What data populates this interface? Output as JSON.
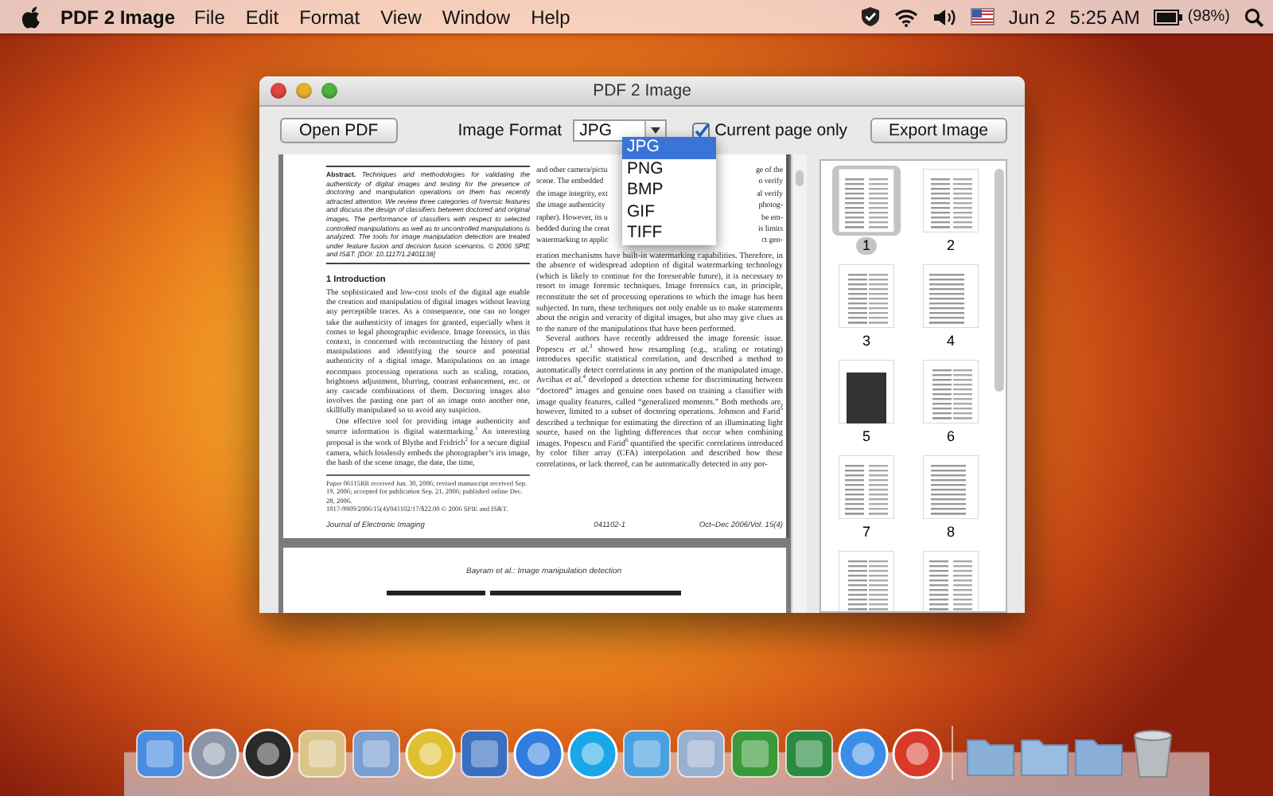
{
  "menu_bar": {
    "app_name": "PDF 2 Image",
    "menus": [
      "File",
      "Edit",
      "Format",
      "View",
      "Window",
      "Help"
    ],
    "date": "Jun 2",
    "time": "5:25 AM",
    "battery": "(98%)"
  },
  "window": {
    "title": "PDF 2 Image"
  },
  "toolbar": {
    "open_button": "Open PDF",
    "format_label": "Image Format",
    "format_value": "JPG",
    "current_page_only": {
      "label": "Current page only",
      "checked": true
    },
    "export_button": "Export Image"
  },
  "format_menu": {
    "options": [
      {
        "label": "JPG",
        "selected": true
      },
      {
        "label": "PNG",
        "selected": false
      },
      {
        "label": "BMP",
        "selected": false
      },
      {
        "label": "GIF",
        "selected": false
      },
      {
        "label": "TIFF",
        "selected": false
      }
    ]
  },
  "document": {
    "page": {
      "abstract": "**Abstract.** Techniques and methodologies for validating the authenticity of digital images and testing for the presence of doctoring and manipulation operations on them has recently attracted attention. We review three categories of forensic features and discuss the design of classifiers between doctored and original images. The performance of classifiers with respect to selected controlled manipulations as well as to uncontrolled manipulations is analyzed. The tools for image manipulation detection are treated under feature fusion and decision fusion scenarios. © 2006 SPIE and IS&T. [DOI: 10.1117/1.2401138]",
      "heading": "1 Introduction",
      "left_paragraphs": [
        "The sophisticated and low-cost tools of the digital age enable the creation and manipulation of digital images without leaving any perceptible traces. As a consequence, one can no longer take the authenticity of images for granted, especially when it comes to legal photographic evidence. Image forensics, in this context, is concerned with reconstructing the history of past manipulations and identifying the source and potential authenticity of a digital image. Manipulations on an image encompass processing operations such as scaling, rotation, brightness adjustment, blurring, contrast enhancement, etc. or any cascade combinations of them. Doctoring images also involves the pasting one part of an image onto another one, skillfully manipulated so to avoid any suspicion.",
        "One effective tool for providing image authenticity and source information is digital watermarking.$^{1}$ An interesting proposal is the work of Blythe and Fridrich$^{2}$ for a secure digital camera, which losslessly embeds the photographer’s iris image, the hash of the scene image, the date, the time,"
      ],
      "footnotes": [
        "Paper 06115RR received Jun. 30, 2006; revised manuscript received Sep. 19, 2006; accepted for publication Sep. 21, 2006; published online Dec. 28, 2006.",
        "1017-9909/2006/15(4)/041102/17/$22.00 © 2006 SPIE and IS&T."
      ],
      "covered_lines": [
        {
          "left": "and other camera/pictu",
          "right": "ge of the"
        },
        {
          "left": "scene. The embedded",
          "right": "o verify"
        },
        {
          "left": "the image integrity, ext",
          "right": "al verify"
        },
        {
          "left": "the image authenticity",
          "right": "photog-"
        },
        {
          "left": "rapher). However, its u",
          "right": "be em-"
        },
        {
          "left": "bedded during the creat",
          "right": "is limits"
        },
        {
          "left": "watermarking to applic",
          "right": "ct gen-"
        }
      ],
      "right_paragraphs": [
        "eration mechanisms have built-in watermarking capabilities. Therefore, in the absence of widespread adoption of digital watermarking technology (which is likely to continue for the foreseeable future), it is necessary to resort to image forensic techniques. Image forensics can, in principle, reconstitute the set of processing operations to which the image has been subjected. In turn, these techniques not only enable us to make statements about the origin and veracity of digital images, but also may give clues as to the nature of the manipulations that have been performed.",
        "Several authors have recently addressed the image forensic issue. Popescu *et al.*$^{3}$ showed how resampling (e.g., scaling or rotating) introduces specific statistical correlation, and described a method to automatically detect correlations in any portion of the manipulated image. Avcibas *et al.*$^{4}$ developed a detection scheme for discriminating between “doctored” images and genuine ones based on training a classifier with image quality features, called “generalized moments.” Both methods are, however, limited to a subset of doctoring operations. Johnson and Farid$^{5}$ described a technique for estimating the direction of an illuminating light source, based on the lighting differences that occur when combining images. Popescu and Farid$^{6}$ quantified the specific correlations introduced by color filter array (CFA) interpolation and described how these correlations, or lack thereof, can be automatically detected in any por-"
      ],
      "footer": {
        "journal": "Journal of Electronic Imaging",
        "page_id": "041102-1",
        "issue": "Oct–Dec 2006/Vol. 15(4)"
      }
    },
    "next_page": {
      "running_head": "Bayram et al.: Image manipulation detection"
    }
  },
  "thumbnails": [
    {
      "label": "1",
      "selected": true
    },
    {
      "label": "2",
      "selected": false
    },
    {
      "label": "3",
      "selected": false
    },
    {
      "label": "4",
      "selected": false
    },
    {
      "label": "5",
      "selected": false
    },
    {
      "label": "6",
      "selected": false
    },
    {
      "label": "7",
      "selected": false
    },
    {
      "label": "8",
      "selected": false
    },
    {
      "selected": false
    },
    {
      "selected": false
    }
  ]
}
